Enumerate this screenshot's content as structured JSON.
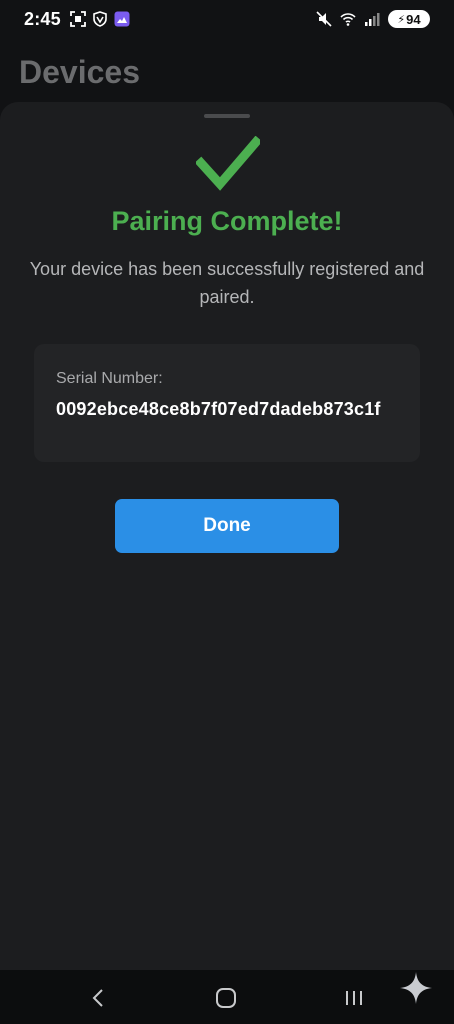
{
  "status_bar": {
    "time": "2:45",
    "battery": "94",
    "left_icons": [
      "screenshot-icon",
      "vpn-shield-icon",
      "gallery-icon"
    ],
    "right_icons": [
      "mute-icon",
      "wifi-icon",
      "signal-icon",
      "battery-icon"
    ]
  },
  "background": {
    "title": "Devices"
  },
  "sheet": {
    "icon": "checkmark-icon",
    "title": "Pairing Complete!",
    "message": "Your device has been successfully registered and paired.",
    "serial": {
      "label": "Serial Number:",
      "value": "0092ebce48ce8b7f07ed7dadeb873c1f"
    },
    "done_label": "Done"
  },
  "nav_bar": {
    "buttons": [
      "back-icon",
      "home-icon",
      "recents-icon",
      "assistant-icon"
    ]
  },
  "colors": {
    "accent_green": "#4caf50",
    "button_blue": "#2b8fe6",
    "sheet_bg": "#1c1d1f",
    "card_bg": "#232426"
  }
}
